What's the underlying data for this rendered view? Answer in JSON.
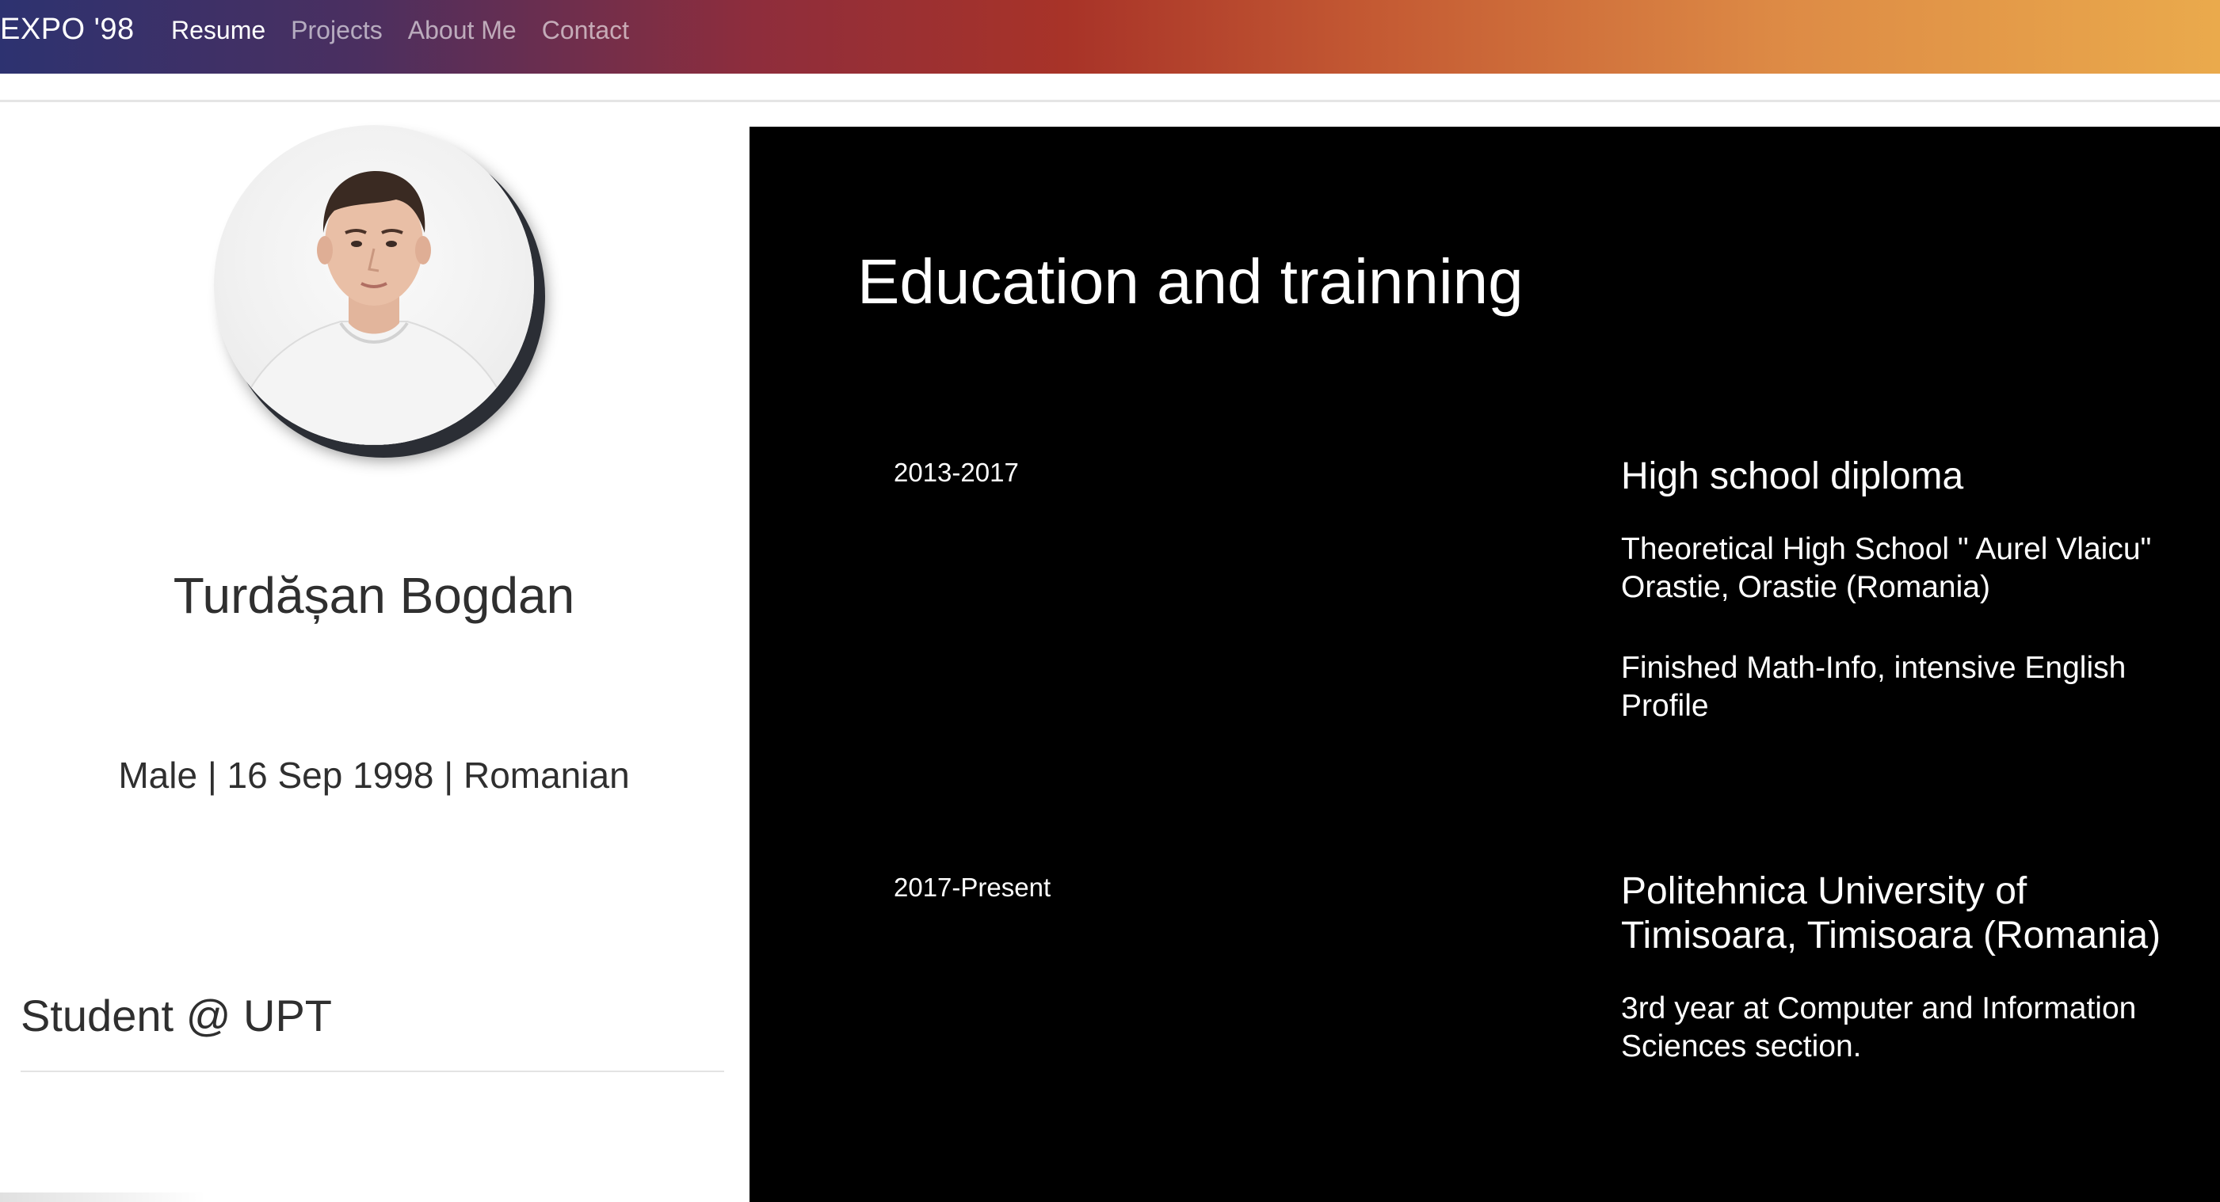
{
  "navbar": {
    "brand": "EXPO '98",
    "links": [
      {
        "label": "Resume",
        "active": true
      },
      {
        "label": "Projects",
        "active": false
      },
      {
        "label": "About Me",
        "active": false
      },
      {
        "label": "Contact",
        "active": false
      }
    ]
  },
  "profile": {
    "name": "Turdășan Bogdan",
    "details": "Male | 16 Sep 1998 | Romanian",
    "role": "Student @ UPT"
  },
  "education": {
    "title": "Education and trainning",
    "items": [
      {
        "date": "2013-2017",
        "heading": "High school diploma",
        "lines": [
          "Theoretical High School \" Aurel Vlaicu\" Orastie, Orastie (Romania)",
          "Finished Math-Info, intensive English Profile"
        ]
      },
      {
        "date": "2017-Present",
        "heading": "Politehnica University of Timisoara, Timisoara (Romania)",
        "lines": [
          "3rd year at Computer and Information Sciences section."
        ]
      }
    ]
  },
  "colors": {
    "gradient_start": "#2d3270",
    "gradient_mid": "#a83328",
    "gradient_end": "#eaaa4c",
    "panel_background": "#000000",
    "text_dark": "#2f2f2f"
  }
}
